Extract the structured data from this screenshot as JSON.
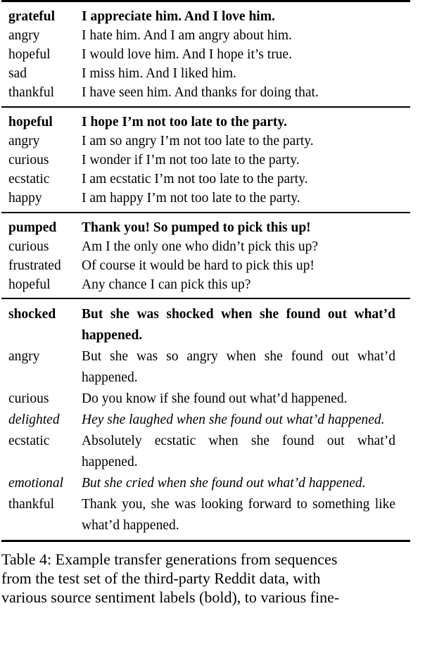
{
  "document": {
    "type": "paper-table",
    "caption_label": "Table 4:"
  },
  "table": {
    "blocks": [
      {
        "id": "block-grateful",
        "rows": [
          {
            "label": "grateful",
            "text": "I appreciate him. And I love him.",
            "style": "bold"
          },
          {
            "label": "angry",
            "text": "I hate him. And I am angry about him.",
            "style": "normal"
          },
          {
            "label": "hopeful",
            "text": "I would love him. And I hope it’s true.",
            "style": "normal"
          },
          {
            "label": "sad",
            "text": "I miss him. And I liked him.",
            "style": "normal"
          },
          {
            "label": "thankful",
            "text": "I have seen him. And thanks for doing that.",
            "style": "normal"
          }
        ]
      },
      {
        "id": "block-hopeful",
        "rows": [
          {
            "label": "hopeful",
            "text": "I hope I’m not too late to the party.",
            "style": "bold"
          },
          {
            "label": "angry",
            "text": "I am so angry I’m not too late to the party.",
            "style": "normal"
          },
          {
            "label": "curious",
            "text": "I wonder if I’m not too late to the party.",
            "style": "normal"
          },
          {
            "label": "ecstatic",
            "text": "I am ecstatic I’m not too late to the party.",
            "style": "normal"
          },
          {
            "label": "happy",
            "text": "I am happy I’m not too late to the party.",
            "style": "normal"
          }
        ]
      },
      {
        "id": "block-pumped",
        "rows": [
          {
            "label": "pumped",
            "text": "Thank you! So pumped to pick this up!",
            "style": "bold"
          },
          {
            "label": "curious",
            "text": "Am I the only one who didn’t pick this up?",
            "style": "normal"
          },
          {
            "label": "frustrated",
            "text": "Of course it would be hard to pick this up!",
            "style": "normal"
          },
          {
            "label": "hopeful",
            "text": "Any chance I can pick this up?",
            "style": "normal"
          }
        ]
      },
      {
        "id": "block-shocked",
        "justified": true,
        "rows": [
          {
            "label": "shocked",
            "text": "But she was shocked when she found out what’d happened.",
            "style": "bold"
          },
          {
            "label": "angry",
            "text": "But she was so angry when she found out what’d happened.",
            "style": "normal"
          },
          {
            "label": "curious",
            "text": "Do you know if she found out what’d hap­pened.",
            "style": "normal"
          },
          {
            "label": "delighted",
            "text": "Hey she laughed when she found out what’d happened.",
            "style": "italic"
          },
          {
            "label": "ecstatic",
            "text": "Absolutely ecstatic when she found out what’d happened.",
            "style": "normal"
          },
          {
            "label": "emotional",
            "text": "But she cried when she found out what’d happened.",
            "style": "italic"
          },
          {
            "label": "thankful",
            "text": "Thank you, she was looking forward to something like what’d happened.",
            "style": "normal"
          }
        ]
      }
    ]
  },
  "caption": {
    "lines": [
      "Table 4: Example transfer generations from sequences",
      "from the test set of the third-party Reddit data, with",
      "various source sentiment labels (bold), to various fine-"
    ]
  }
}
